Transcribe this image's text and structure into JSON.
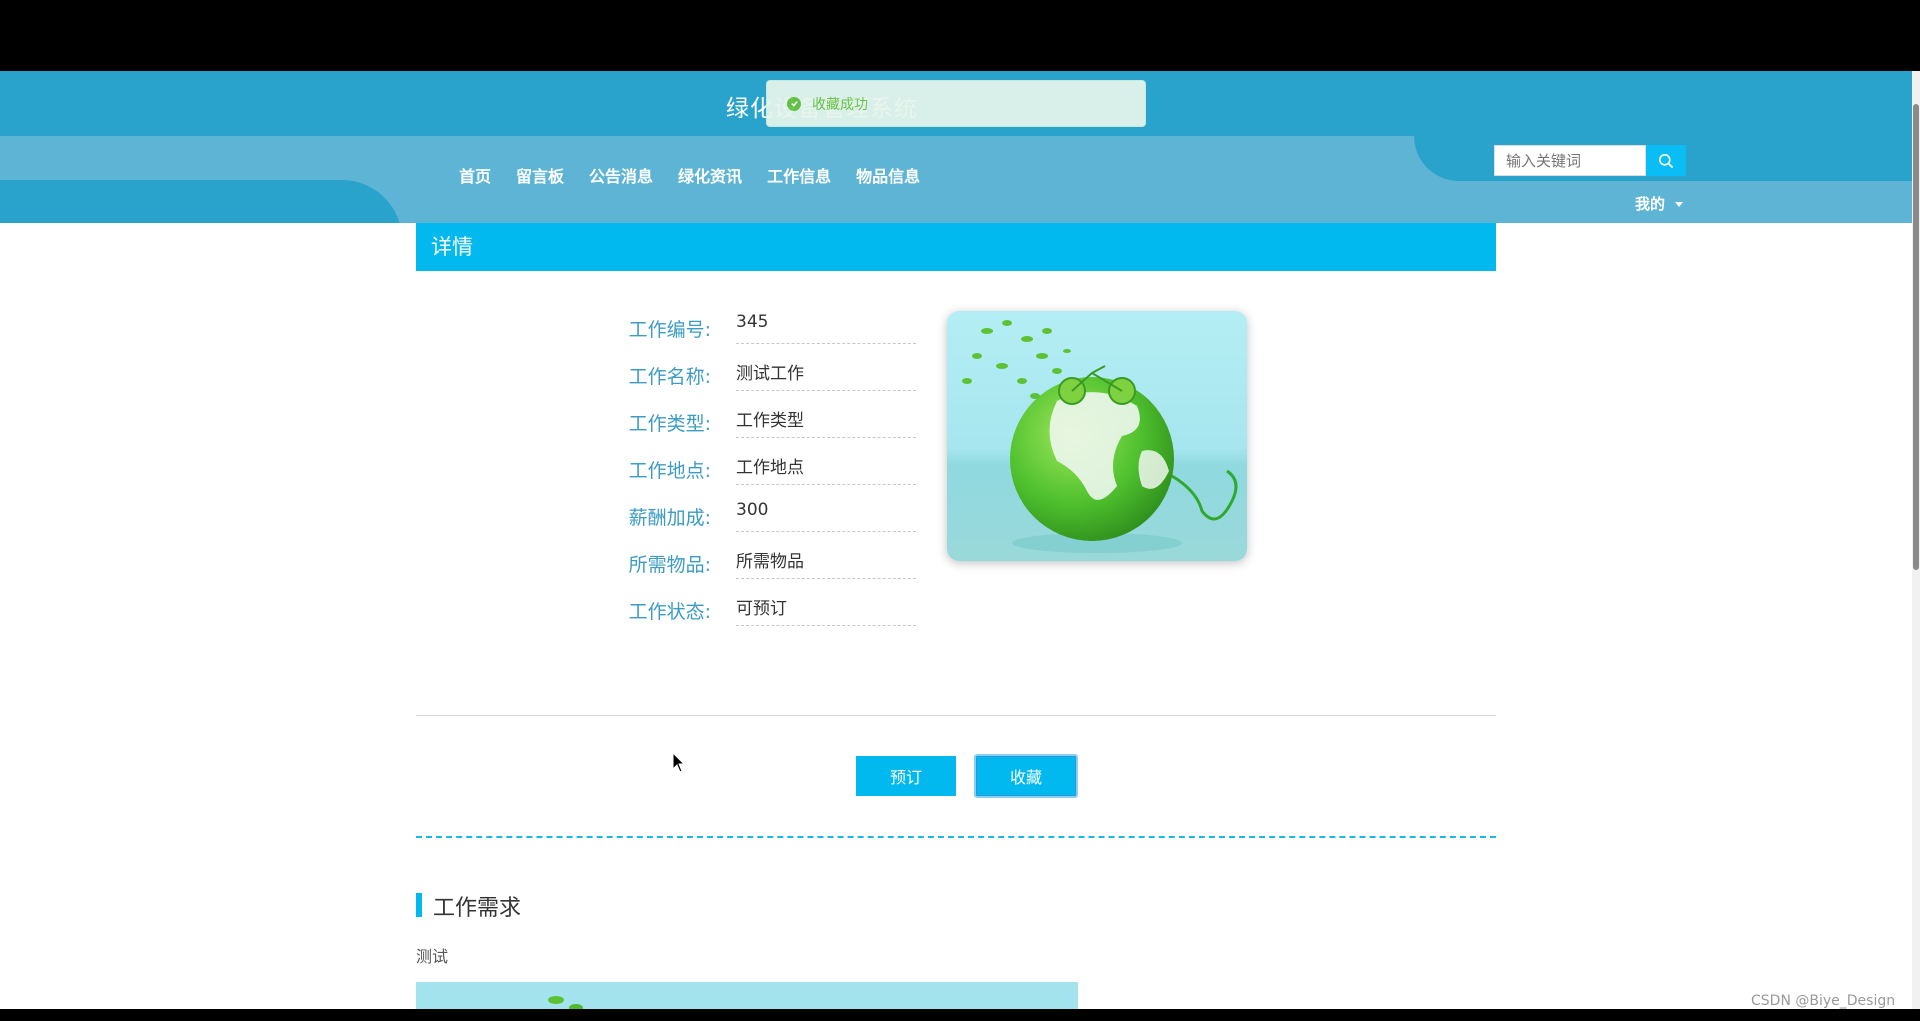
{
  "header": {
    "site_title": "绿化设备管理系统",
    "nav": [
      "首页",
      "留言板",
      "公告消息",
      "绿化资讯",
      "工作信息",
      "物品信息"
    ],
    "search_placeholder": "输入关键词",
    "user_menu": "我的"
  },
  "toast": {
    "message": "收藏成功",
    "type": "success"
  },
  "detail": {
    "title": "详情",
    "fields": [
      {
        "label": "工作编号:",
        "value": "345"
      },
      {
        "label": "工作名称:",
        "value": "测试工作"
      },
      {
        "label": "工作类型:",
        "value": "工作类型"
      },
      {
        "label": "工作地点:",
        "value": "工作地点"
      },
      {
        "label": "薪酬加成:",
        "value": "300"
      },
      {
        "label": "所需物品:",
        "value": "所需物品"
      },
      {
        "label": "工作状态:",
        "value": "可预订"
      }
    ],
    "image_icon": "green-earth-bicycle-image",
    "buttons": {
      "reserve": "预订",
      "favorite": "收藏"
    }
  },
  "requirements": {
    "title": "工作需求",
    "text": "测试"
  },
  "watermark": "CSDN @Biye_Design",
  "colors": {
    "primary": "#02b9ef",
    "header": "#2aa3cc",
    "nav": "#5db4d5",
    "label": "#3c9cc3",
    "success": "#67c23a"
  }
}
